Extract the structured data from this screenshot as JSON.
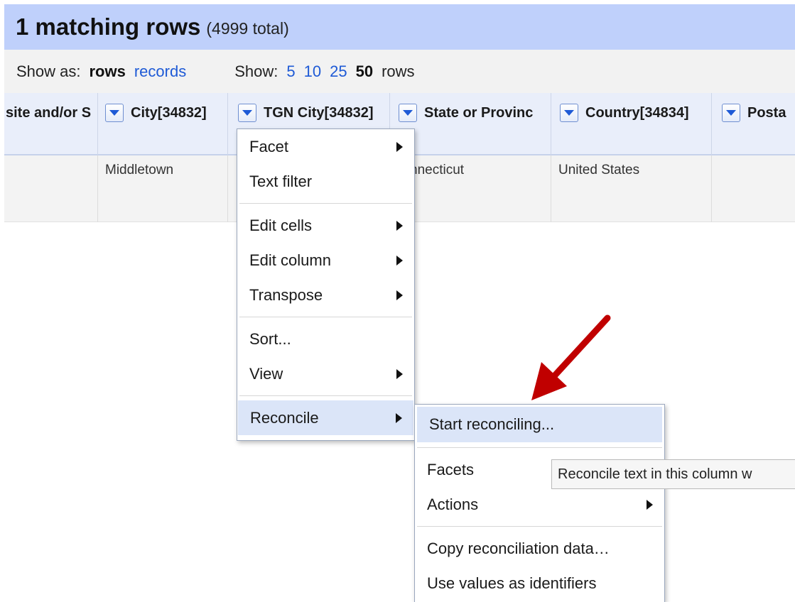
{
  "header": {
    "matching": "1 matching rows",
    "total": "(4999 total)"
  },
  "show_as": {
    "label": "Show as:",
    "current": "rows",
    "alternate": "records"
  },
  "show_count": {
    "label": "Show:",
    "options": [
      "5",
      "10",
      "25"
    ],
    "current": "50",
    "suffix": "rows"
  },
  "columns": [
    "site and/or S",
    "City[34832]",
    "TGN City[34832]",
    "State or Provinc",
    "Country[34834]",
    "Posta"
  ],
  "row": {
    "city": "Middletown",
    "state": "nnecticut",
    "country": "United States"
  },
  "column_menu": {
    "facet": "Facet",
    "text_filter": "Text filter",
    "edit_cells": "Edit cells",
    "edit_column": "Edit column",
    "transpose": "Transpose",
    "sort": "Sort...",
    "view": "View",
    "reconcile": "Reconcile"
  },
  "reconcile_menu": {
    "start": "Start reconciling...",
    "facets": "Facets",
    "actions": "Actions",
    "copy_data": "Copy reconciliation data…",
    "use_values": "Use values as identifiers"
  },
  "tooltip": "Reconcile text in this column w",
  "colors": {
    "header_bg": "#bfd0fb",
    "link": "#1e5ad6",
    "highlight": "#dbe5f8",
    "annotation_arrow": "#c00000"
  }
}
